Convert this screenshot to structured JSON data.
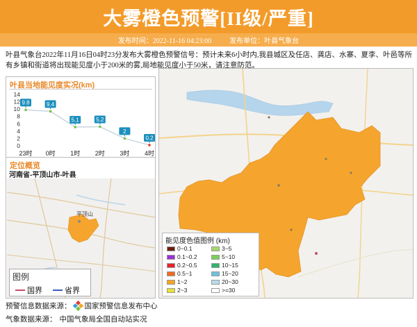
{
  "header": {
    "title": "大雾橙色预警[II级/严重]"
  },
  "subbar": {
    "publish_time": "发布时间：2022-11-16 04:23:00",
    "publisher": "发布单位：叶县气象台"
  },
  "description": "叶县气象台2022年11月16日04时23分发布大雾橙色预警信号：预计未来6小时内,我县城区及任店、龚店、水寨、夏李、叶邑等所有乡镇和街道将出现能见度小于200米的雾,局地能见度小于50米，请注意防范。",
  "chart_panel": {
    "title": "叶县当地能见度实况(km)"
  },
  "chart_data": {
    "type": "line",
    "title": "叶县当地能见度实况(km)",
    "categories": [
      "23时",
      "0时",
      "1时",
      "2时",
      "3时",
      "4时"
    ],
    "values": [
      9.8,
      9.4,
      5.1,
      5.2,
      2,
      0.2
    ],
    "yticks": [
      0,
      2,
      4,
      6,
      8,
      10,
      12,
      14
    ],
    "ylim": [
      0,
      14
    ],
    "colors": {
      "line": "#c9d6df",
      "point": "#7ac143",
      "last_point": "#e23b2e",
      "label_bg": "#1c8fbd"
    }
  },
  "location_panel": {
    "title": "定位概览",
    "subtitle": "河南省-平顶山市-叶县",
    "minimap_city": "平顶山"
  },
  "map_legend": {
    "title": "图例",
    "country_border": "国界",
    "province_border": "省界"
  },
  "vis_legend": {
    "title": "能见度色值图例 (km)",
    "items": [
      {
        "label": "0~0.1",
        "color": "#6b1f0f"
      },
      {
        "label": "3~5",
        "color": "#a6d96a"
      },
      {
        "label": "0.1~0.2",
        "color": "#9b30d9"
      },
      {
        "label": "5~10",
        "color": "#7ad15a"
      },
      {
        "label": "0.2~0.5",
        "color": "#e5252a"
      },
      {
        "label": "10~15",
        "color": "#33b36b"
      },
      {
        "label": "0.5~1",
        "color": "#f26b1f"
      },
      {
        "label": "15~20",
        "color": "#6fc1e0"
      },
      {
        "label": "1~2",
        "color": "#f5a31f"
      },
      {
        "label": "20~30",
        "color": "#b9dcef"
      },
      {
        "label": "2~3",
        "color": "#e6e13a"
      },
      {
        "label": ">=30",
        "color": "#ffffff"
      }
    ]
  },
  "footer": {
    "source1_label": "预警信息数据来源：",
    "source1_value": "国家预警信息发布中心",
    "source2_label": "气象数据来源：",
    "source2_value": "中国气象局全国自动站实况"
  },
  "colors": {
    "accent": "#f39b2a",
    "warning_area": "#f5a52d"
  }
}
